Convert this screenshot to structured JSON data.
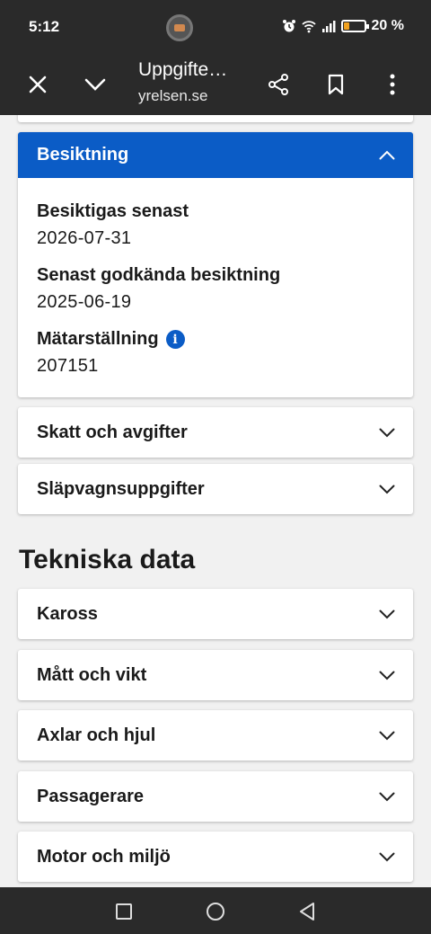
{
  "status_bar": {
    "time": "5:12",
    "battery_text": "20 %",
    "icons": [
      "alarm-icon",
      "wifi-icon",
      "signal-icon",
      "battery-icon"
    ]
  },
  "browser": {
    "title": "Uppgifte…",
    "url": "yrelsen.se",
    "close_icon": "close-icon",
    "expand_icon": "chevron-down-icon",
    "share_icon": "share-icon",
    "bookmark_icon": "bookmark-icon",
    "menu_icon": "more-vert-icon"
  },
  "besiktning": {
    "header": "Besiktning",
    "fields": [
      {
        "label": "Besiktigas senast",
        "value": "2026-07-31"
      },
      {
        "label": "Senast godkända besiktning",
        "value": "2025-06-19"
      },
      {
        "label": "Mätarställning",
        "value": "207151"
      }
    ],
    "info_glyph": "i"
  },
  "sections_top": [
    {
      "label": "Skatt och avgifter"
    },
    {
      "label": "Släpvagnsuppgifter"
    }
  ],
  "tekniska": {
    "title": "Tekniska data",
    "sections": [
      {
        "label": "Kaross"
      },
      {
        "label": "Mått och vikt"
      },
      {
        "label": "Axlar och hjul"
      },
      {
        "label": "Passagerare"
      },
      {
        "label": "Motor och miljö"
      }
    ]
  },
  "colors": {
    "accent": "#0b5cc6",
    "bar": "#2a2a2a",
    "page_bg": "#f1f1f1"
  }
}
